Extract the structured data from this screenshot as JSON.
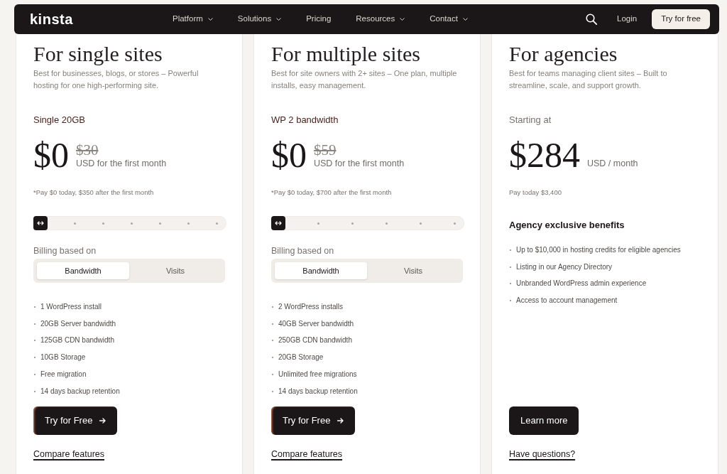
{
  "nav": {
    "logo": "kinsta",
    "items": [
      {
        "label": "Platform",
        "dropdown": true
      },
      {
        "label": "Solutions",
        "dropdown": true
      },
      {
        "label": "Pricing",
        "dropdown": false
      },
      {
        "label": "Resources",
        "dropdown": true
      },
      {
        "label": "Contact",
        "dropdown": true
      }
    ],
    "login": "Login",
    "cta": "Try for free"
  },
  "plans": [
    {
      "kind": "plan",
      "title": "For single sites",
      "description": "Best for businesses, blogs, or stores – Powerful hosting for one high-performing site.",
      "plan_name": "Single 20GB",
      "price": "$0",
      "original_price": "$30",
      "price_term": "USD for the first month",
      "fine_print": "*Pay $0 today, $350 after the first month",
      "slider": {
        "stops": [
          {
            "selected": true
          },
          {
            "selected": false
          },
          {
            "selected": false
          },
          {
            "selected": false
          },
          {
            "selected": false
          },
          {
            "selected": false
          },
          {
            "selected": false
          }
        ]
      },
      "billing": {
        "label": "Billing based on",
        "options": [
          {
            "label": "Bandwidth",
            "selected": true
          },
          {
            "label": "Visits",
            "selected": false
          }
        ]
      },
      "features": [
        "1 WordPress install",
        "20GB Server bandwidth",
        "125GB CDN bandwidth",
        "10GB Storage",
        "Free migration",
        "14 days backup retention"
      ],
      "cta": "Try for Free",
      "link": "Compare features"
    },
    {
      "kind": "plan",
      "title": "For multiple sites",
      "description": "Best for site owners with 2+ sites – One plan, multiple installs, easy management.",
      "plan_name": "WP 2 bandwidth",
      "price": "$0",
      "original_price": "$59",
      "price_term": "USD for the first month",
      "fine_print": "*Pay $0 today, $700 after the first month",
      "slider": {
        "stops": [
          {
            "selected": true
          },
          {
            "selected": false
          },
          {
            "selected": false
          },
          {
            "selected": false
          },
          {
            "selected": false
          },
          {
            "selected": false
          }
        ]
      },
      "billing": {
        "label": "Billing based on",
        "options": [
          {
            "label": "Bandwidth",
            "selected": true
          },
          {
            "label": "Visits",
            "selected": false
          }
        ]
      },
      "features": [
        "2 WordPress installs",
        "40GB Server bandwidth",
        "250GB CDN bandwidth",
        "20GB Storage",
        "Unlimited free migrations",
        "14 days backup retention"
      ],
      "cta": "Try for Free",
      "link": "Compare features"
    },
    {
      "kind": "agency",
      "title": "For agencies",
      "description": "Best for teams managing client sites – Built to streamline, scale, and support growth.",
      "plan_name": "Starting at",
      "price": "$284",
      "price_term": "USD / month",
      "fine_print": "Pay today $3,400",
      "features_title": "Agency exclusive benefits",
      "features": [
        "Up to $10,000 in hosting credits for eligible agencies",
        "Listing in our Agency Directory",
        "Unbranded WordPress admin experience",
        "Access to account management"
      ],
      "cta": "Learn more",
      "link": "Have questions?"
    }
  ]
}
